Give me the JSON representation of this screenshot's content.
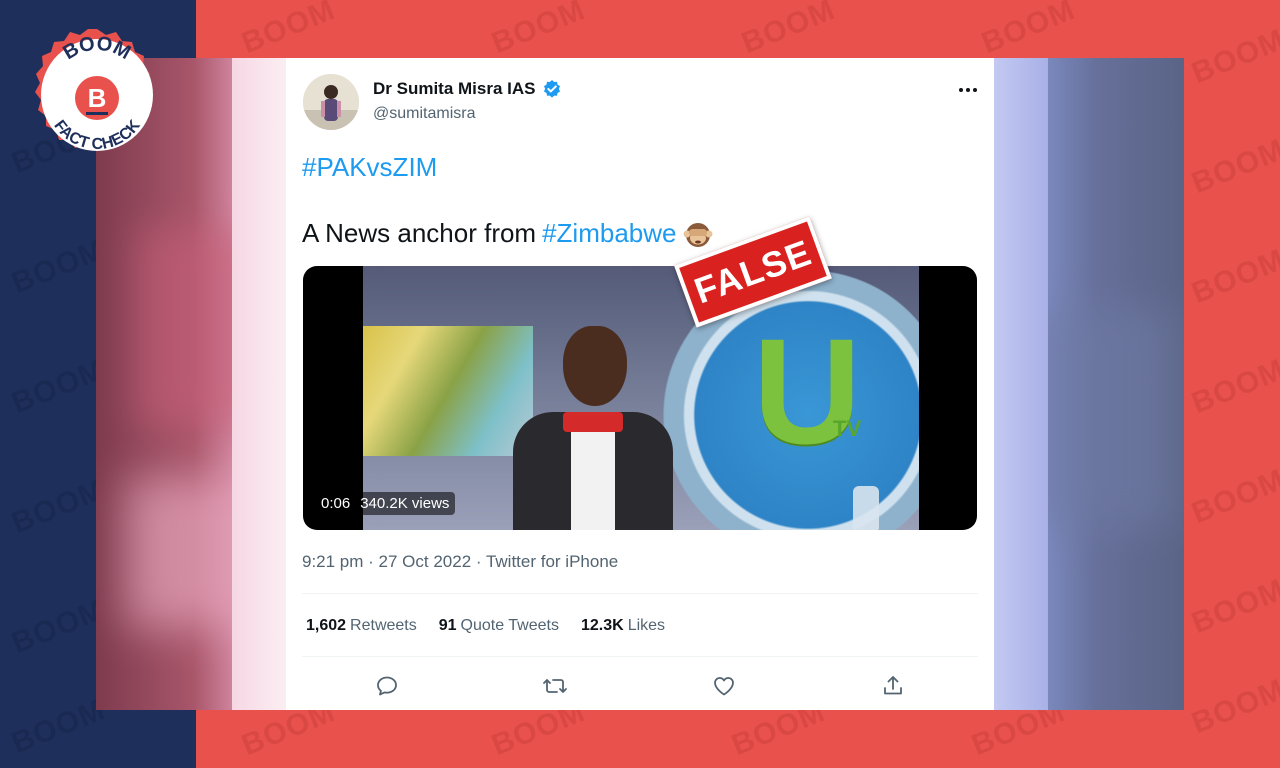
{
  "brand": {
    "name": "BOOM",
    "sub": "FACT CHECK",
    "letter": "B",
    "watermark": "BOOM",
    "colors": {
      "navy": "#1f2f5c",
      "red": "#e9514c",
      "stamp_red": "#d9211f"
    }
  },
  "stamp": {
    "label": "FALSE"
  },
  "tweet": {
    "author_name": "Dr Sumita Misra IAS",
    "author_handle": "@sumitamisra",
    "hashtag": "#PAKvsZIM",
    "text_prefix": "A News anchor from",
    "text_tag": "#Zimbabwe",
    "emoji": "see-no-evil-monkey",
    "video": {
      "duration": "0:06",
      "views": "340.2K views"
    },
    "timestamp": "9:21 pm · 27 Oct 2022 · Twitter for iPhone",
    "stats": {
      "retweets_count": "1,602",
      "retweets_label": "Retweets",
      "quotes_count": "91",
      "quotes_label": "Quote Tweets",
      "likes_count": "12.3K",
      "likes_label": "Likes"
    },
    "icons": [
      "reply-icon",
      "retweet-icon",
      "like-icon",
      "share-icon"
    ],
    "colors": {
      "link": "#1d9bf0",
      "muted": "#536471",
      "text": "#0f1419"
    }
  }
}
